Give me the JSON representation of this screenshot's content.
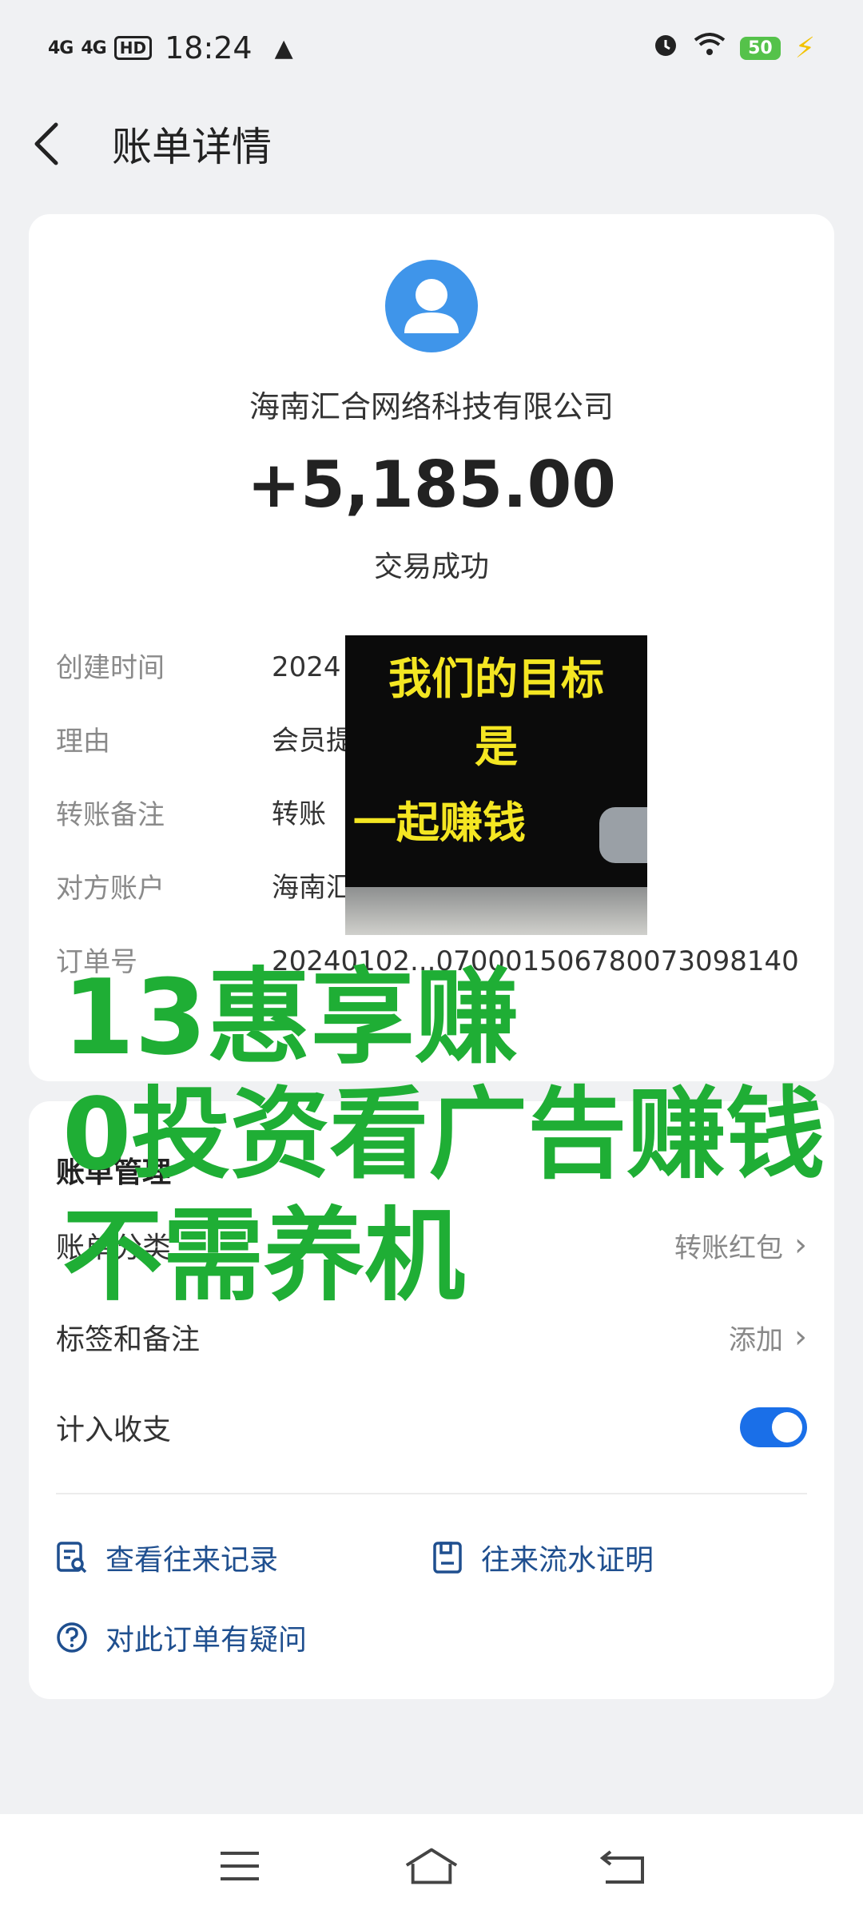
{
  "status_bar": {
    "signal_1": "4G",
    "signal_2": "4G",
    "hd_label": "HD",
    "time": "18:24",
    "battery": "50"
  },
  "header": {
    "title": "账单详情"
  },
  "transaction": {
    "company": "海南汇合网络科技有限公司",
    "amount": "+5,185.00",
    "status": "交易成功"
  },
  "details": [
    {
      "key": "创建时间",
      "value": "2024"
    },
    {
      "key": "理由",
      "value": "会员提"
    },
    {
      "key": "转账备注",
      "value": "转账"
    },
    {
      "key": "对方账户",
      "value": "海南汇"
    },
    {
      "key": "订单号",
      "value": "20240102...0700015067800730981​40"
    }
  ],
  "management": {
    "title": "账单管理",
    "category_label": "账单分类",
    "category_value": "转账红包",
    "tags_label": "标签和备注",
    "tags_value": "添加",
    "income_label": "计入收支",
    "income_enabled": true
  },
  "links": {
    "history": "查看往来记录",
    "proof": "往来流水证明",
    "question": "对此订单有疑问"
  },
  "overlay_image": {
    "line1": "我们的目标",
    "line2": "是",
    "line3": "一起赚钱"
  },
  "promo": {
    "line1": "13惠享赚",
    "line2": "0投资看广告赚钱",
    "line3": "不需养机"
  },
  "colors": {
    "accent": "#1a6fe8",
    "avatar": "#3f95ea",
    "promo_green": "#1fae35",
    "overlay_text": "#f4e622"
  },
  "icons": [
    "back-arrow-icon",
    "alarm-icon",
    "wifi-icon",
    "warning-icon",
    "avatar-icon",
    "record-icon",
    "proof-icon",
    "question-icon",
    "menu-icon",
    "home-icon",
    "return-icon"
  ]
}
